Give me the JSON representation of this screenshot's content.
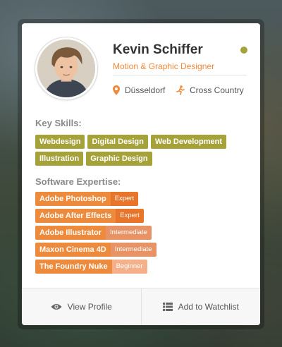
{
  "profile": {
    "name": "Kevin Schiffer",
    "role": "Motion & Graphic Designer",
    "location": "Düsseldorf",
    "sport": "Cross Country"
  },
  "status_color": "#a5a23a",
  "accent_color": "#ee8a3c",
  "skills_color": "#a5a23a",
  "sections": {
    "skills_title": "Key Skills:",
    "software_title": "Software Expertise:"
  },
  "skills": [
    "Webdesign",
    "Digital Design",
    "Web Development",
    "Illustration",
    "Graphic Design"
  ],
  "software": [
    {
      "name": "Adobe Photoshop",
      "level": "Expert"
    },
    {
      "name": "Adobe After Effects",
      "level": "Expert"
    },
    {
      "name": "Adobe Illustrator",
      "level": "Intermediate"
    },
    {
      "name": "Maxon Cinema 4D",
      "level": "Intermediate"
    },
    {
      "name": "The Foundry Nuke",
      "level": "Beginner"
    }
  ],
  "icons": {
    "location": "map-pin-icon",
    "sport": "runner-icon",
    "view": "eye-icon",
    "watchlist": "list-grid-icon"
  },
  "actions": {
    "view_profile": "View Profile",
    "add_to_watchlist": "Add to Watchlist"
  }
}
